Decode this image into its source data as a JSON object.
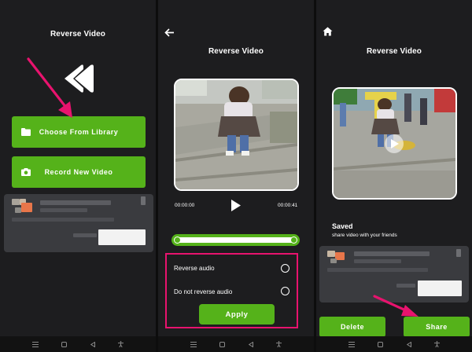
{
  "screen1": {
    "title": "Reverse Video",
    "choose_button": "Choose From Library",
    "record_button": "Record New Video"
  },
  "screen2": {
    "title": "Reverse Video",
    "time_start": "00:00:00",
    "time_end": "00:00:41",
    "progress": 1.0,
    "option_reverse": "Reverse audio",
    "option_no_reverse": "Do not reverse audio",
    "apply_button": "Apply"
  },
  "screen3": {
    "title": "Reverse Video",
    "saved_label": "Saved",
    "share_prompt": "share video with your friends",
    "delete_button": "Delete",
    "share_button": "Share"
  },
  "colors": {
    "accent_green": "#55b21a",
    "highlight_pink": "#e8136e",
    "screen_bg": "#1d1d1f"
  },
  "icons": [
    "back-logo-icon",
    "folder-icon",
    "camera-icon",
    "back-arrow-icon",
    "play-icon",
    "home-icon",
    "nav-menu-icon",
    "nav-home-icon",
    "nav-back-icon",
    "accessibility-icon"
  ]
}
